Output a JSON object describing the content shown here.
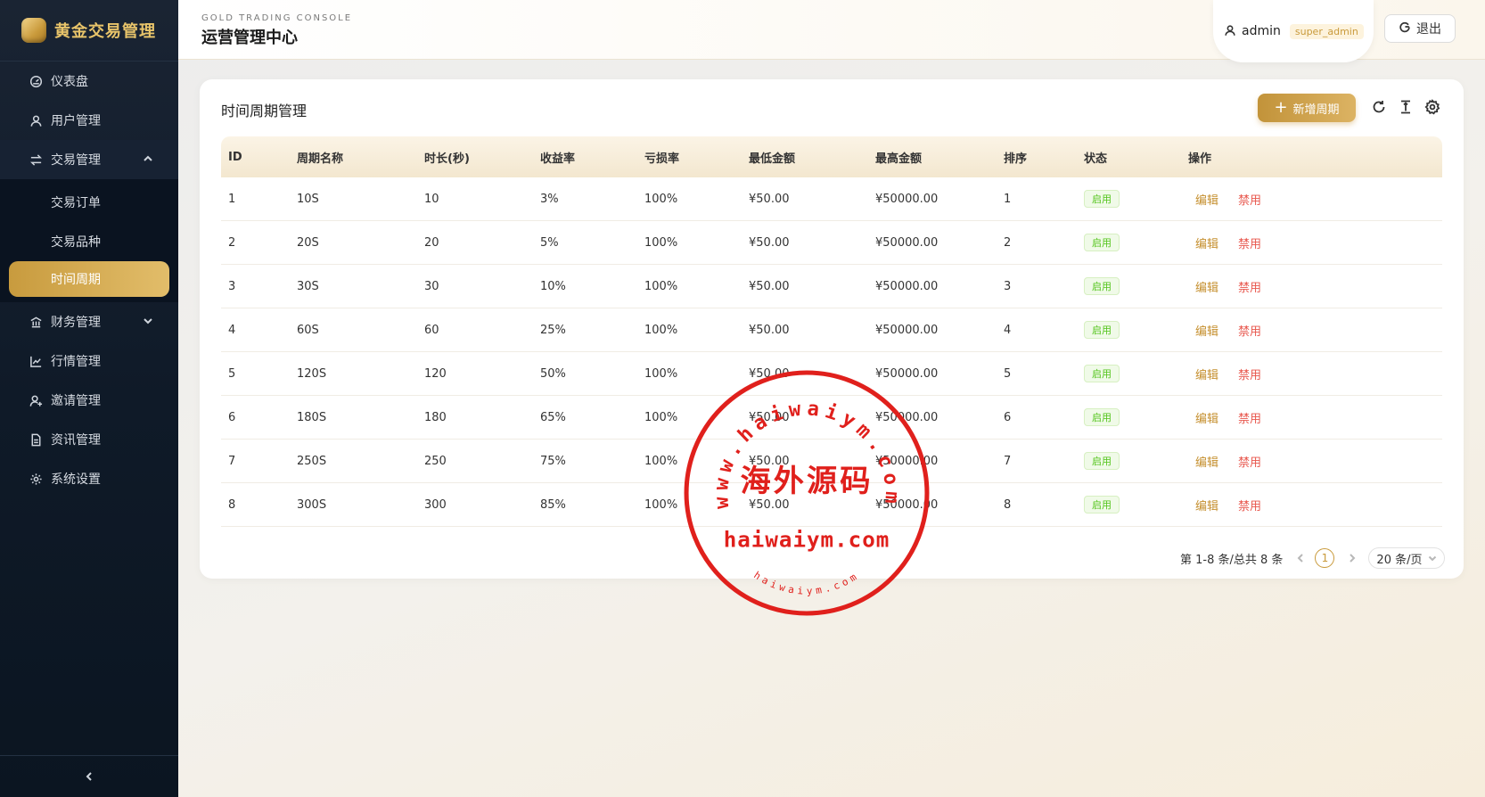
{
  "sidebar": {
    "logo_text": "黄金交易管理",
    "items": [
      {
        "label": "仪表盘",
        "icon": "dashboard-icon"
      },
      {
        "label": "用户管理",
        "icon": "user-icon"
      },
      {
        "label": "交易管理",
        "icon": "swap-icon",
        "expanded": true
      },
      {
        "label": "财务管理",
        "icon": "bank-icon"
      },
      {
        "label": "行情管理",
        "icon": "line-chart-icon"
      },
      {
        "label": "邀请管理",
        "icon": "invite-icon"
      },
      {
        "label": "资讯管理",
        "icon": "document-icon"
      },
      {
        "label": "系统设置",
        "icon": "gear-icon"
      }
    ],
    "trade_submenu": [
      {
        "label": "交易订单"
      },
      {
        "label": "交易品种"
      },
      {
        "label": "时间周期",
        "active": true
      }
    ]
  },
  "header": {
    "subtitle": "GOLD TRADING CONSOLE",
    "title": "运营管理中心",
    "user": "admin",
    "role": "super_admin",
    "logout": "退出"
  },
  "card": {
    "title": "时间周期管理",
    "add_button": "新增周期",
    "add_icon": "+"
  },
  "table": {
    "columns": [
      "ID",
      "周期名称",
      "时长(秒)",
      "收益率",
      "亏损率",
      "最低金额",
      "最高金额",
      "排序",
      "状态",
      "操作"
    ],
    "rows": [
      {
        "id": "1",
        "name": "10S",
        "duration": "10",
        "profit": "3%",
        "loss": "100%",
        "min": "¥50.00",
        "max": "¥50000.00",
        "sort": "1",
        "status": "启用"
      },
      {
        "id": "2",
        "name": "20S",
        "duration": "20",
        "profit": "5%",
        "loss": "100%",
        "min": "¥50.00",
        "max": "¥50000.00",
        "sort": "2",
        "status": "启用"
      },
      {
        "id": "3",
        "name": "30S",
        "duration": "30",
        "profit": "10%",
        "loss": "100%",
        "min": "¥50.00",
        "max": "¥50000.00",
        "sort": "3",
        "status": "启用"
      },
      {
        "id": "4",
        "name": "60S",
        "duration": "60",
        "profit": "25%",
        "loss": "100%",
        "min": "¥50.00",
        "max": "¥50000.00",
        "sort": "4",
        "status": "启用"
      },
      {
        "id": "5",
        "name": "120S",
        "duration": "120",
        "profit": "50%",
        "loss": "100%",
        "min": "¥50.00",
        "max": "¥50000.00",
        "sort": "5",
        "status": "启用"
      },
      {
        "id": "6",
        "name": "180S",
        "duration": "180",
        "profit": "65%",
        "loss": "100%",
        "min": "¥50.00",
        "max": "¥50000.00",
        "sort": "6",
        "status": "启用"
      },
      {
        "id": "7",
        "name": "250S",
        "duration": "250",
        "profit": "75%",
        "loss": "100%",
        "min": "¥50.00",
        "max": "¥50000.00",
        "sort": "7",
        "status": "启用"
      },
      {
        "id": "8",
        "name": "300S",
        "duration": "300",
        "profit": "85%",
        "loss": "100%",
        "min": "¥50.00",
        "max": "¥50000.00",
        "sort": "8",
        "status": "启用"
      }
    ],
    "action_edit": "编辑",
    "action_disable": "禁用"
  },
  "pagination": {
    "summary": "第 1-8 条/总共 8 条",
    "current_page": "1",
    "page_size": "20 条/页"
  },
  "watermark": {
    "outer_text": "www.haiwaiym.com",
    "center_text": "海外源码",
    "main_text": "haiwaiym.com",
    "inner_text": "haiwaiym.com",
    "color": "#e0201c"
  },
  "colors": {
    "accent_gold": "#c99a3b",
    "sidebar_bg": "#0f1a28",
    "status_green": "#52c41a",
    "danger_red": "#e8574d"
  }
}
